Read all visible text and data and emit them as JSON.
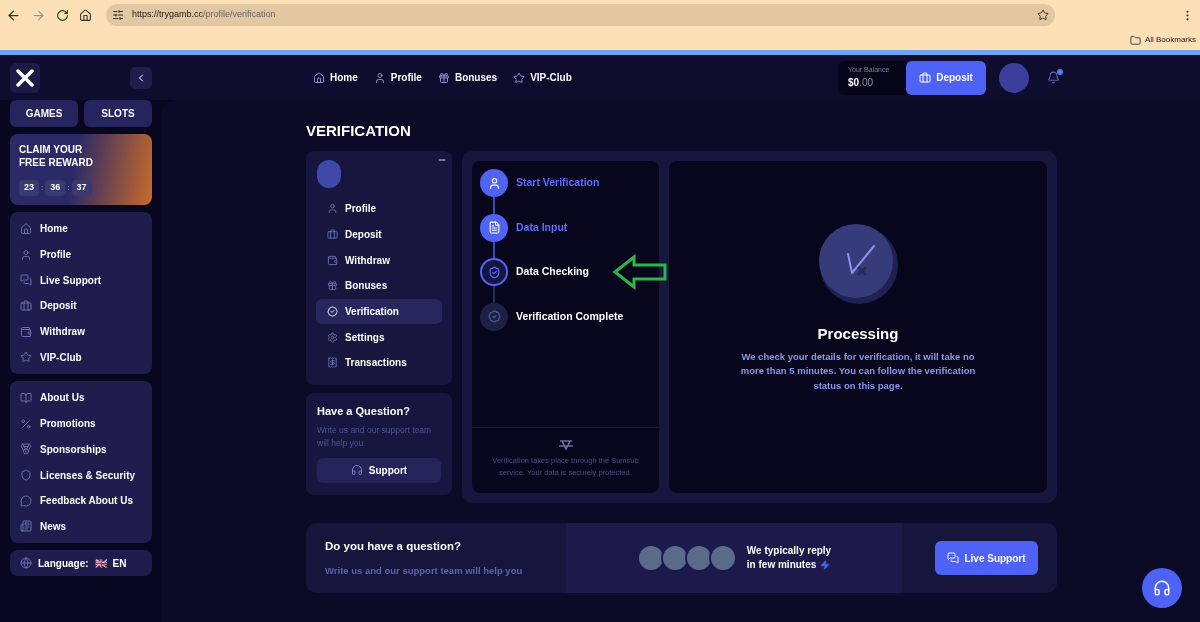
{
  "browser": {
    "url_host": "https://trygamb.cc",
    "url_path": "/profile/verification",
    "bookmarks": "All Bookmarks"
  },
  "header": {
    "nav": [
      "Home",
      "Profile",
      "Bonuses",
      "VIP-Club"
    ],
    "balance": {
      "label": "Your Balance",
      "whole": "$0",
      "fraction": ".00"
    },
    "deposit": "Deposit",
    "notification": true
  },
  "sidebar": {
    "tabs": [
      "GAMES",
      "SLOTS"
    ],
    "reward": {
      "title": "CLAIM YOUR FREE REWARD",
      "timer": [
        {
          "kind": "digits",
          "text": "23"
        },
        {
          "kind": "separator",
          "text": ":"
        },
        {
          "kind": "digits",
          "text": "36"
        },
        {
          "kind": "separator",
          "text": ":"
        },
        {
          "kind": "digits",
          "text": "37"
        }
      ]
    },
    "main_items": [
      "Home",
      "Profile",
      "Live Support",
      "Deposit",
      "Withdraw",
      "VIP-Club"
    ],
    "info_items": [
      "About Us",
      "Promotions",
      "Sponsorships",
      "Licenses & Security",
      "Feedback About Us",
      "News"
    ],
    "language": {
      "label": "Language:",
      "flag": "🇬🇧",
      "code": "EN"
    }
  },
  "page": {
    "title": "VERIFICATION",
    "profile_menu": [
      {
        "label": "Profile",
        "selected": false
      },
      {
        "label": "Deposit",
        "selected": false
      },
      {
        "label": "Withdraw",
        "selected": false
      },
      {
        "label": "Bonuses",
        "selected": false
      },
      {
        "label": "Verification",
        "selected": true
      },
      {
        "label": "Settings",
        "selected": false
      },
      {
        "label": "Transactions",
        "selected": false
      }
    ],
    "question_card": {
      "title": "Have a Question?",
      "text": "Write us and our support team will help you",
      "button": "Support"
    },
    "steps": [
      {
        "label": "Start Verification",
        "completed": true,
        "current": false
      },
      {
        "label": "Data Input",
        "completed": true,
        "current": false
      },
      {
        "label": "Data Checking",
        "completed": false,
        "current": true
      },
      {
        "label": "Verification Complete",
        "completed": false,
        "current": false
      }
    ],
    "steps_note": "Verification takes place through the Sumsub service. Your data is securely protected.",
    "processing": {
      "title": "Processing",
      "text": "We check your details for verification, it will take no more than 5 minutes. You can follow the verification status on this page."
    },
    "banner": {
      "title": "Do you have a question?",
      "text": "Write us and our support team will help you",
      "reply_lines": [
        "We typically reply",
        "in few minutes"
      ],
      "button": "Live Support"
    }
  }
}
